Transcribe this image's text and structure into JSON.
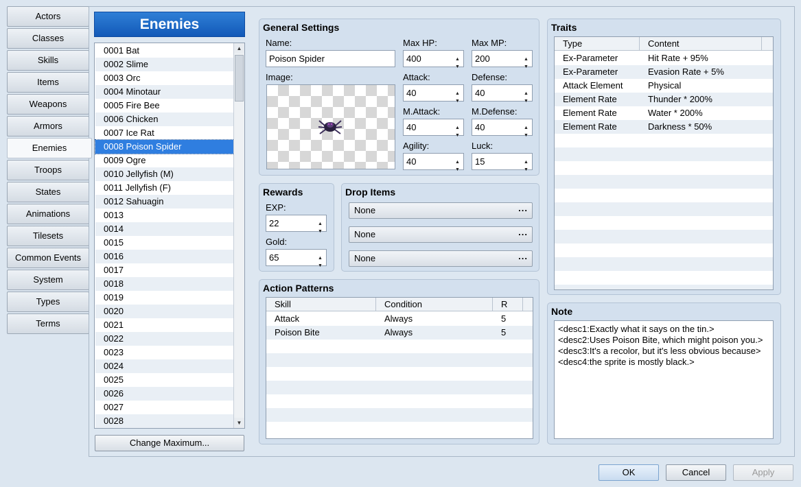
{
  "nav": {
    "tabs": [
      "Actors",
      "Classes",
      "Skills",
      "Items",
      "Weapons",
      "Armors",
      "Enemies",
      "Troops",
      "States",
      "Animations",
      "Tilesets",
      "Common Events",
      "System",
      "Types",
      "Terms"
    ],
    "active": "Enemies"
  },
  "list": {
    "title": "Enemies",
    "items": [
      "0001 Bat",
      "0002 Slime",
      "0003 Orc",
      "0004 Minotaur",
      "0005 Fire Bee",
      "0006 Chicken",
      "0007 Ice Rat",
      "0008 Poison Spider",
      "0009 Ogre",
      "0010 Jellyfish (M)",
      "0011 Jellyfish (F)",
      "0012 Sahuagin",
      "0013",
      "0014",
      "0015",
      "0016",
      "0017",
      "0018",
      "0019",
      "0020",
      "0021",
      "0022",
      "0023",
      "0024",
      "0025",
      "0026",
      "0027",
      "0028"
    ],
    "selected": "0008 Poison Spider",
    "change_max_label": "Change Maximum..."
  },
  "general": {
    "title": "General Settings",
    "name_label": "Name:",
    "name_value": "Poison Spider",
    "image_label": "Image:",
    "stats": {
      "max_hp": {
        "label": "Max HP:",
        "value": "400"
      },
      "max_mp": {
        "label": "Max MP:",
        "value": "200"
      },
      "attack": {
        "label": "Attack:",
        "value": "40"
      },
      "defense": {
        "label": "Defense:",
        "value": "40"
      },
      "m_attack": {
        "label": "M.Attack:",
        "value": "40"
      },
      "m_defense": {
        "label": "M.Defense:",
        "value": "40"
      },
      "agility": {
        "label": "Agility:",
        "value": "40"
      },
      "luck": {
        "label": "Luck:",
        "value": "15"
      }
    }
  },
  "rewards": {
    "title": "Rewards",
    "exp_label": "EXP:",
    "exp_value": "22",
    "gold_label": "Gold:",
    "gold_value": "65"
  },
  "drop_items": {
    "title": "Drop Items",
    "items": [
      "None",
      "None",
      "None"
    ],
    "more_label": "..."
  },
  "action_patterns": {
    "title": "Action Patterns",
    "columns": [
      "Skill",
      "Condition",
      "R"
    ],
    "rows": [
      {
        "skill": "Attack",
        "condition": "Always",
        "r": "5"
      },
      {
        "skill": "Poison Bite",
        "condition": "Always",
        "r": "5"
      }
    ]
  },
  "traits": {
    "title": "Traits",
    "columns": [
      "Type",
      "Content"
    ],
    "rows": [
      {
        "type": "Ex-Parameter",
        "content": "Hit Rate + 95%"
      },
      {
        "type": "Ex-Parameter",
        "content": "Evasion Rate + 5%"
      },
      {
        "type": "Attack Element",
        "content": "Physical"
      },
      {
        "type": "Element Rate",
        "content": "Thunder * 200%"
      },
      {
        "type": "Element Rate",
        "content": "Water * 200%"
      },
      {
        "type": "Element Rate",
        "content": "Darkness * 50%"
      }
    ]
  },
  "note": {
    "title": "Note",
    "lines": [
      "<desc1:Exactly what it says on the tin.>",
      "<desc2:Uses Poison Bite, which might poison you.>",
      "<desc3:It's a recolor, but it's less obvious because>",
      "<desc4:the sprite is mostly black.>"
    ]
  },
  "footer": {
    "ok_label": "OK",
    "cancel_label": "Cancel",
    "apply_label": "Apply"
  },
  "icons": {
    "spin": "spin-arrows-icon",
    "scroll_up": "scroll-up-arrow-icon",
    "scroll_down": "scroll-down-arrow-icon",
    "enemy_sprite": "spider-sprite-icon"
  },
  "colors": {
    "accent": "#1a66c8",
    "selection": "#2f7ee0",
    "panel": "#d3e0ee"
  }
}
